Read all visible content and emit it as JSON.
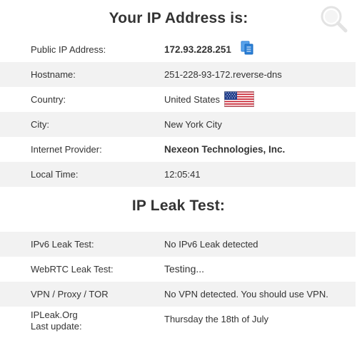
{
  "ip_section": {
    "title": "Your IP Address is:",
    "rows": [
      {
        "label": "Public IP Address:",
        "value": "172.93.228.251"
      },
      {
        "label": "Hostname:",
        "value": "251-228-93-172.reverse-dns"
      },
      {
        "label": "Country:",
        "value": "United States"
      },
      {
        "label": "City:",
        "value": "New York City"
      },
      {
        "label": "Internet Provider:",
        "value": "Nexeon Technologies, Inc."
      },
      {
        "label": "Local Time:",
        "value": "12:05:41"
      }
    ]
  },
  "leak_section": {
    "title": "IP Leak Test:",
    "rows": [
      {
        "label": "IPv6 Leak Test:",
        "value": "No IPv6 Leak detected"
      },
      {
        "label": "WebRTC Leak Test:",
        "value": "Testing..."
      },
      {
        "label": "VPN / Proxy / TOR",
        "value": "No VPN detected. You should use VPN."
      },
      {
        "label_line1": "IPLeak.Org",
        "label_line2": "Last update:",
        "value": "Thursday the 18th of July"
      }
    ]
  },
  "icons": {
    "logo": "magnifier-logo-icon",
    "copy": "copy-icon",
    "flag": "us-flag-icon"
  },
  "colors": {
    "row_shade": "#f2f2f2",
    "copy_icon": "#2b7fd6",
    "flag_red": "#c8202f",
    "flag_blue": "#1f3d8c"
  }
}
